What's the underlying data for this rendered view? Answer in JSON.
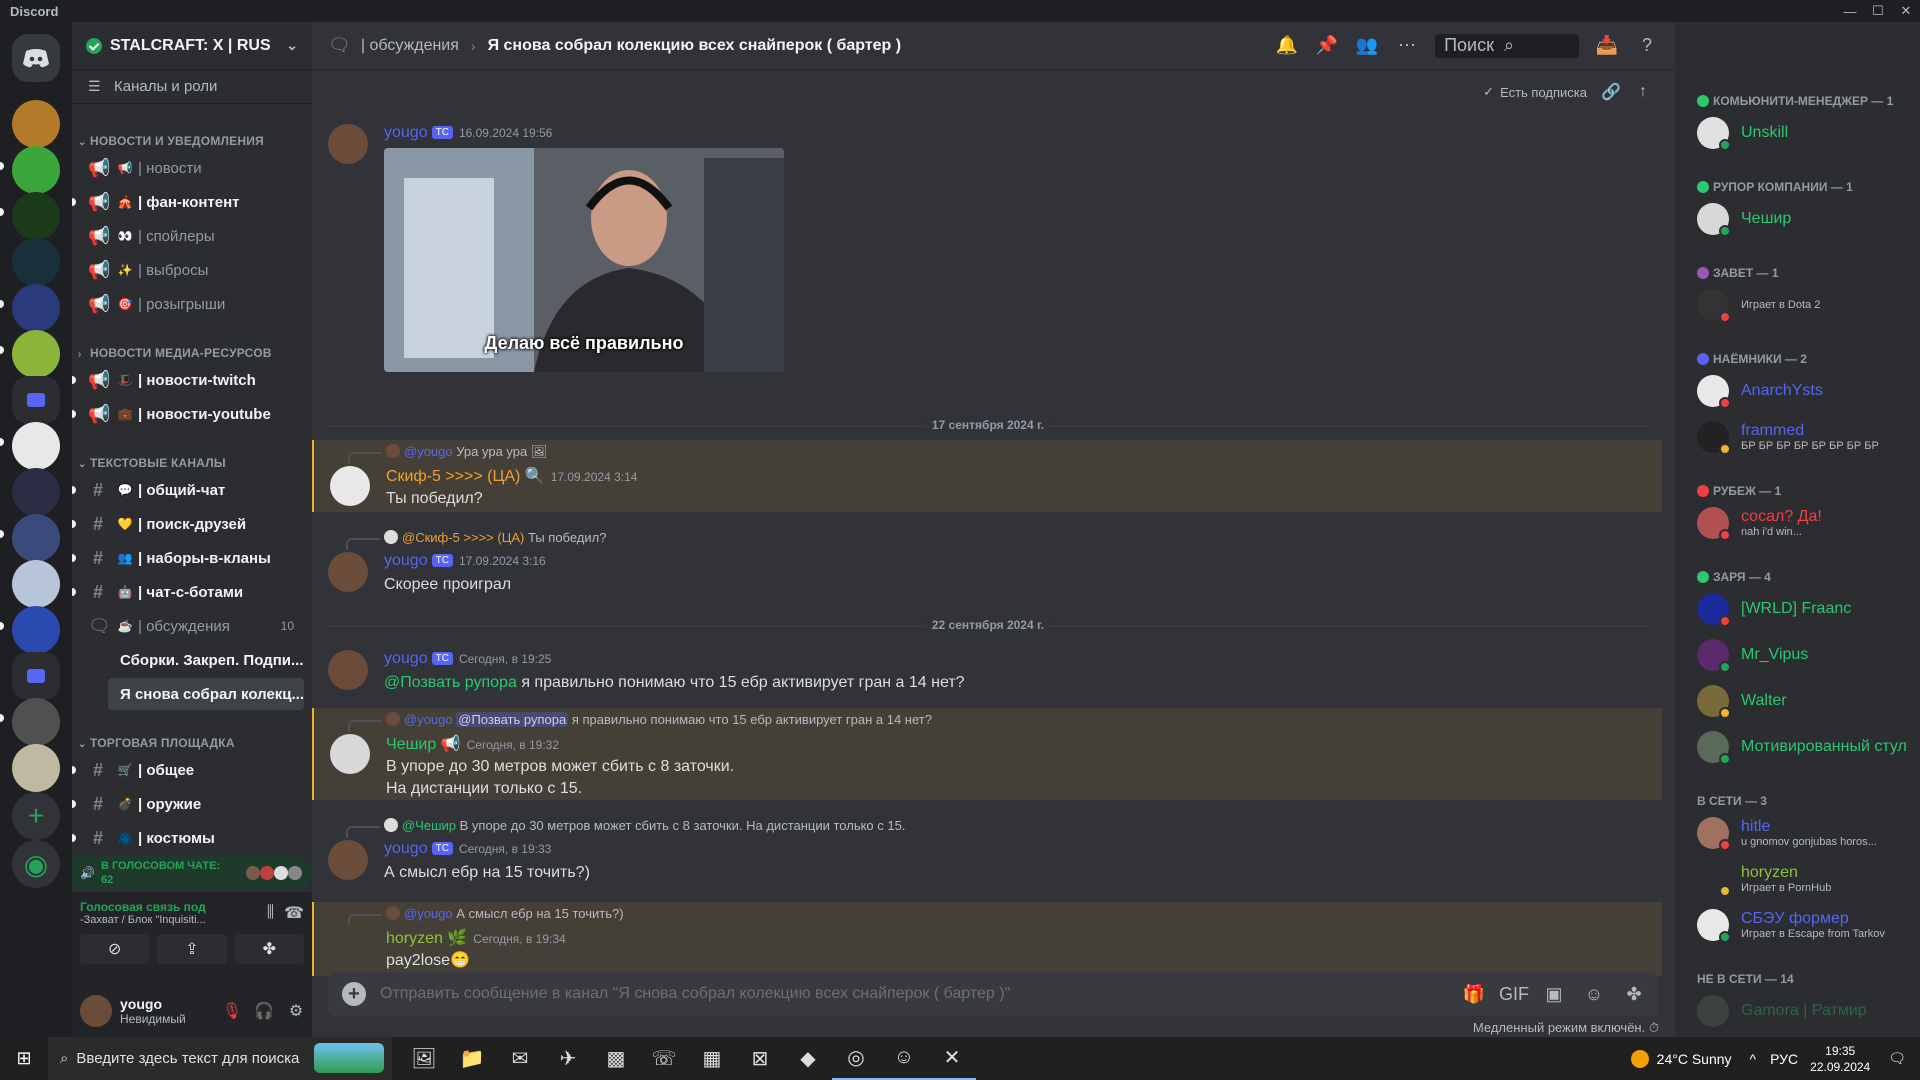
{
  "window": {
    "title": "Discord"
  },
  "server": {
    "name": "STALCRAFT: X | RUS",
    "channels_roles": "Каналы и роли"
  },
  "categories": [
    {
      "label": "НОВОСТИ И УВЕДОМЛЕНИЯ"
    },
    {
      "label": "НОВОСТИ МЕДИА-РЕСУРСОВ"
    },
    {
      "label": "ТЕКСТОВЫЕ КАНАЛЫ"
    },
    {
      "label": "ТОРГОВАЯ ПЛОЩАДКА"
    }
  ],
  "channels": [
    {
      "name": "| новости",
      "emoji": "📢"
    },
    {
      "name": "| фан-контент",
      "emoji": "🎪"
    },
    {
      "name": "| спойлеры",
      "emoji": "👀"
    },
    {
      "name": "| выбросы",
      "emoji": "✨"
    },
    {
      "name": "| розыгрыши",
      "emoji": "🎯"
    },
    {
      "name": "| новости-twitch",
      "emoji": "🎩"
    },
    {
      "name": "| новости-youtube",
      "emoji": "💼"
    },
    {
      "name": "| общий-чат",
      "emoji": "💬"
    },
    {
      "name": "| поиск-друзей",
      "emoji": "💛"
    },
    {
      "name": "| наборы-в-кланы",
      "emoji": "👥"
    },
    {
      "name": "| чат-с-ботами",
      "emoji": "🤖"
    },
    {
      "name": "| обсуждения",
      "emoji": "☕",
      "count": "10"
    },
    {
      "name": "| общее",
      "emoji": "🛒"
    },
    {
      "name": "| оружие",
      "emoji": "💣"
    },
    {
      "name": "| костюмы",
      "emoji": "🧥"
    }
  ],
  "threads": [
    {
      "name": "Сборки. Закреп. Подпи..."
    },
    {
      "name": "Я снова собрал колекц..."
    }
  ],
  "voice": {
    "in_voice_label": "В ГОЛОСОВОМ ЧАТЕ:",
    "in_voice_count": "62",
    "connected_label": "Голосовая связь под",
    "connected_sub": "-Захват / Блок \"Inquisiti..."
  },
  "user": {
    "name": "yougo",
    "status": "Невидимый"
  },
  "topbar": {
    "channel": "| обсуждения",
    "thread": "Я снова собрал колекцию всех снайперок ( бартер )",
    "search_placeholder": "Поиск"
  },
  "subbar": {
    "subscribed": "Есть подписка"
  },
  "messages": [
    {
      "author": "yougo",
      "tag": "TC",
      "time": "16.09.2024 19:56",
      "gif_caption": "Делаю всё правильно",
      "color": "#5865f2"
    },
    {
      "divider": "17 сентября 2024 г."
    },
    {
      "reply_author": "@yougo",
      "reply_text": "Ура ура ура",
      "author": "Скиф-5 >>>> (ЦА)",
      "time": "17.09.2024 3:14",
      "text": "Ты победил?",
      "color": "#f0a030"
    },
    {
      "reply_author": "@Скиф-5 >>>> (ЦА)",
      "reply_text": "Ты победил?",
      "author": "yougo",
      "tag": "TC",
      "time": "17.09.2024 3:16",
      "text": "Скорее проиграл",
      "color": "#5865f2"
    },
    {
      "divider": "22 сентября 2024 г."
    },
    {
      "author": "yougo",
      "tag": "TC",
      "time": "Сегодня, в 19:25",
      "mention": "@Позвать рупора",
      "text": "я правильно понимаю что 15 ебр активирует гран а 14 нет?",
      "color": "#5865f2"
    },
    {
      "reply_author": "@yougo",
      "reply_mention": "@Позвать рупора",
      "reply_text": "я правильно понимаю что 15 ебр активирует гран а 14 нет?",
      "author": "Чешир",
      "time": "Сегодня, в 19:32",
      "text": "В упоре до 30 метров может сбить с 8 заточки.",
      "text2": "На дистанции только с 15.",
      "color": "#2dc770"
    },
    {
      "reply_author": "@Чешир",
      "reply_text": "В упоре до 30 метров может сбить с 8 заточки.  На дистанции только с 15.",
      "author": "yougo",
      "tag": "TC",
      "time": "Сегодня, в 19:33",
      "text": "А смысл ебр на 15 точить?)",
      "color": "#5865f2"
    },
    {
      "reply_author": "@yougo",
      "reply_text": "А смысл ебр на 15 точить?)",
      "author": "horyzen",
      "time": "Сегодня, в 19:34",
      "text": "pay2lose😁",
      "color": "#8fbf3f"
    }
  ],
  "composer": {
    "placeholder": "Отправить сообщение в канал \"Я снова собрал колекцию всех снайперок ( бартер )\"",
    "slowmode": "Медленный режим включён."
  },
  "member_groups": [
    {
      "label": "КОМЬЮНИТИ-МЕНЕДЖЕР — 1",
      "members": [
        {
          "name": "Unskill",
          "color": "#2dc770",
          "status": "#23a559"
        }
      ]
    },
    {
      "label": "РУПОР КОМПАНИИ — 1",
      "members": [
        {
          "name": "Чешир",
          "color": "#2dc770",
          "status": "#23a559"
        }
      ]
    },
    {
      "label": "ЗАВЕТ — 1",
      "members": [
        {
          "name": "",
          "activity": "Играет в Dota 2",
          "color": "#dbdee1",
          "status": "#f23f43"
        }
      ]
    },
    {
      "label": "НАЁМНИКИ — 2",
      "members": [
        {
          "name": "AnarchYsts",
          "color": "#5865f2",
          "status": "#f23f43"
        },
        {
          "name": "frammed",
          "activity": "БР БР БР БР БР БР БР БР",
          "color": "#5865f2",
          "status": "#f0b232"
        }
      ]
    },
    {
      "label": "РУБЕЖ — 1",
      "members": [
        {
          "name": "сосал? Да!",
          "activity": "nah i'd win...",
          "color": "#f23f43",
          "status": "#f23f43"
        }
      ]
    },
    {
      "label": "ЗАРЯ — 4",
      "members": [
        {
          "name": "[WRLD] Fraanc",
          "color": "#2dc770",
          "status": "#f23f43"
        },
        {
          "name": "Mr_Vipus",
          "color": "#2dc770",
          "status": "#23a559"
        },
        {
          "name": "Walter",
          "color": "#2dc770",
          "status": "#f0b232"
        },
        {
          "name": "Мотивированный стул",
          "color": "#2dc770",
          "status": "#23a559"
        }
      ]
    },
    {
      "label": "В СЕТИ — 3",
      "members": [
        {
          "name": "hitle",
          "activity": "u gnomov gonjubas horos...",
          "color": "#5865f2",
          "status": "#f23f43"
        },
        {
          "name": "horyzen",
          "activity": "Играет в PornHub",
          "color": "#8fbf3f",
          "status": "#f0b232"
        },
        {
          "name": "СБЭУ формер",
          "activity": "Играет в Escape from Tarkov",
          "color": "#5865f2",
          "status": "#23a559"
        }
      ]
    },
    {
      "label": "НЕ В СЕТИ — 14",
      "members": [
        {
          "name": "Gamora | Ратмир",
          "color": "#2dc770",
          "status": ""
        }
      ]
    }
  ],
  "taskbar": {
    "search_placeholder": "Введите здесь текст для поиска",
    "weather": "24°C  Sunny",
    "lang": "РУС",
    "time": "19:35",
    "date": "22.09.2024"
  }
}
